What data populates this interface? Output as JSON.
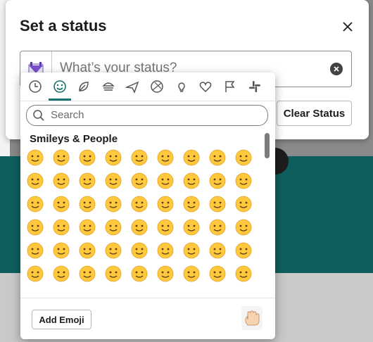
{
  "modal": {
    "title": "Set a status"
  },
  "status": {
    "placeholder": "What’s your status?"
  },
  "buttons": {
    "clear_status": "Clear Status",
    "add_emoji": "Add Emoji"
  },
  "picker": {
    "search_placeholder": "Search",
    "section_title": "Smileys & People",
    "tabs": [
      "clock-icon",
      "smiley-icon",
      "leaf-icon",
      "burger-icon",
      "plane-icon",
      "ball-icon",
      "lightbulb-icon",
      "heart-icon",
      "flag-icon",
      "slack-icon"
    ]
  },
  "colors": {
    "accent": "#16706d",
    "emoji_face": "#ffc83d"
  },
  "emoji_rows": [
    [
      "blush",
      "smile",
      "sunglasses",
      "heart-eyes",
      "kiss",
      "kissing",
      "kiss-smile",
      "kiss-closed",
      "relaxed"
    ],
    [
      "slight-smile",
      "hug",
      "star-struck",
      "thinking",
      "raised-brow",
      "neutral",
      "expressionless",
      "no-mouth",
      "eye-roll"
    ],
    [
      "smirk",
      "persevere",
      "disappointed-relieved",
      "open-mouth",
      "zipper",
      "hushed",
      "sleepy",
      "tired",
      "sleeping"
    ],
    [
      "relieved",
      "tongue",
      "wink-tongue",
      "squint-tongue",
      "drool",
      "unamused",
      "sweat",
      "pensive",
      "confused"
    ],
    [
      "upside-down",
      "money",
      "astonished",
      "frown",
      "slight-frown",
      "confounded",
      "disappointed",
      "worried",
      "triumph"
    ],
    [
      "cry",
      "sob",
      "frown-open",
      "anguished",
      "fearful",
      "weary",
      "exploding",
      "grimace",
      "cold-sweat"
    ]
  ]
}
